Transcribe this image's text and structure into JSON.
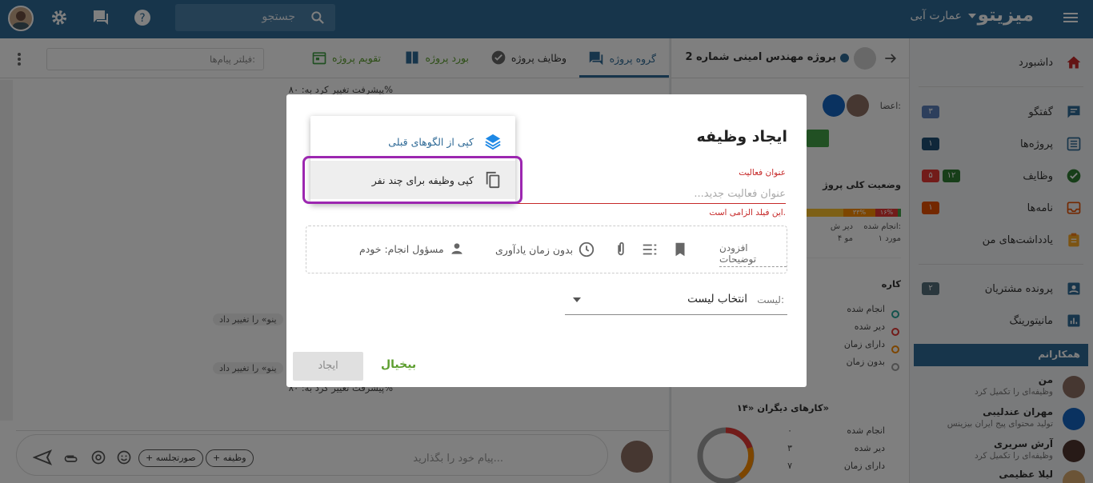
{
  "topbar": {
    "logo": "میزیتو",
    "org": "عمارت آبی",
    "search_placeholder": "جستجو"
  },
  "sidebar": {
    "dashboard": "داشبورد",
    "chat": "گفتگو",
    "chat_badge": "۳",
    "projects": "پروژه‌ها",
    "projects_badge": "۱",
    "tasks": "وظایف",
    "tasks_badge_green": "۱۲",
    "tasks_badge_red": "۵",
    "letters": "نامه‌ها",
    "letters_badge": "۱",
    "notes": "یادداشت‌های من",
    "customers": "پرونده مشتریان",
    "customers_badge": "۲",
    "monitoring": "مانیتورینگ",
    "colleagues_header": "همکارانم",
    "colleagues": [
      {
        "name": "من",
        "status": "وظیفه‌ای را تکمیل کرد"
      },
      {
        "name": "مهران عندلیبی",
        "status": "تولید محتوای پیج ایران بیزینس"
      },
      {
        "name": "آرش سریری",
        "status": "وظیفه‌ای را تکمیل کرد"
      },
      {
        "name": "لیلا عظیمی",
        "status": ""
      }
    ]
  },
  "project": {
    "title": "پروژه مهندس امینی شماره 2",
    "members_label": "اعضا:",
    "status_title": "وضعیت کلی پروژ",
    "pct_red": "۱۶%",
    "pct_orange": "۳۳%",
    "done_label": "انجام شده:",
    "done_count": "۱ مورد",
    "late_label": "دیر ش",
    "late_count": "۴ مو",
    "my_tasks_title": "کاره",
    "my_stats": [
      "انجام شده",
      "دیر شده",
      "دارای زمان",
      "بدون زمان"
    ],
    "others_title": "کارهای دیگران «۱۴»",
    "others_stats": [
      {
        "label": "انجام شده",
        "value": "۰"
      },
      {
        "label": "دیر شده",
        "value": "۳"
      },
      {
        "label": "دارای زمان",
        "value": "۷"
      }
    ]
  },
  "chat": {
    "tabs": {
      "group": "گروه پروژه",
      "tasks": "وظایف پروژه",
      "board": "بورد پروژه",
      "calendar": "تقویم پروژه"
    },
    "filter_placeholder": "فیلتر پیام‌ها:",
    "message_top": "پیشرفت تغییر کرد به: ۸۰%",
    "message_change_1": "ینو» را تغییر داد",
    "message_change_2": "ینو» را تغییر داد",
    "message_bottom": "پیشرفت تغییر کرد به: ۸۰%",
    "compose_placeholder": "پیام خود را بگذارید...",
    "chip_task": "+ وظیفه",
    "chip_minutes": "+ صورتجلسه"
  },
  "dialog": {
    "title": "ایجاد وظیفه",
    "field_label": "عنوان فعالیت",
    "field_placeholder": "عنوان فعالیت جدید...",
    "field_error": "این فیلد الزامی است.",
    "add_description": "افزودن توضیحات",
    "reminder": "بدون زمان یادآوری",
    "assignee": "مسؤول انجام: خودم",
    "list_label": "لیست:",
    "list_value": "انتخاب لیست",
    "create_button": "ایجاد",
    "cancel_button": "بیخیال",
    "menu": {
      "copy_template": "کپی از الگوهای قبلی",
      "copy_multi": "کپی وظیفه برای چند نفر"
    }
  },
  "colors": {
    "primary": "#2f6a96",
    "highlight": "#9c27b0",
    "error": "#c62828",
    "cancel": "#5d9e2f"
  }
}
